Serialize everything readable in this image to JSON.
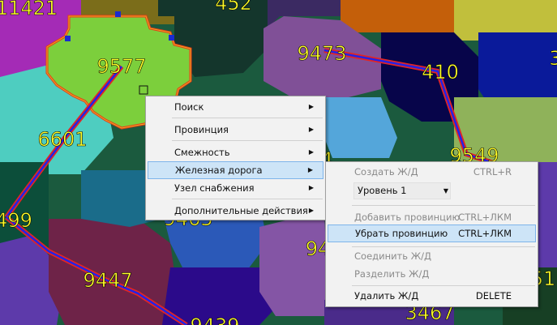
{
  "map": {
    "province_labels": [
      {
        "text": "11421",
        "dname": "province-label-11421"
      },
      {
        "text": "452",
        "dname": "province-label-452"
      },
      {
        "text": "9577",
        "dname": "province-label-9577"
      },
      {
        "text": "9473",
        "dname": "province-label-9473"
      },
      {
        "text": "410",
        "dname": "province-label-410"
      },
      {
        "text": "6601",
        "dname": "province-label-6601"
      },
      {
        "text": "9549",
        "dname": "province-label-9549"
      },
      {
        "text": "499",
        "dname": "province-label-499"
      },
      {
        "text": "9447",
        "dname": "province-label-9447"
      },
      {
        "text": "3467",
        "dname": "province-label-3467"
      },
      {
        "text": "3",
        "dname": "province-label-partial-right-top"
      },
      {
        "text": "94",
        "dname": "province-label-partial-94"
      },
      {
        "text": "51",
        "dname": "province-label-partial-51"
      },
      {
        "text": "9439",
        "dname": "province-label-partial-bottom"
      },
      {
        "text": "9463",
        "dname": "province-label-partial-hidden"
      },
      {
        "text": "4",
        "dname": "province-label-partial-4"
      }
    ],
    "selected_province": "9577",
    "railway_colors": {
      "core": "#2323e6",
      "edge": "#e32424"
    },
    "selection_color": "#e83818"
  },
  "context_menu": {
    "items": [
      {
        "label": "Поиск",
        "has_submenu": true
      },
      {
        "label": "Провинция",
        "has_submenu": true
      },
      {
        "label": "Смежность",
        "has_submenu": true
      },
      {
        "label": "Железная дорога",
        "has_submenu": true,
        "highlighted": true
      },
      {
        "label": "Узел снабжения",
        "has_submenu": true
      },
      {
        "label": "Дополнительные действия",
        "has_submenu": true
      }
    ]
  },
  "railway_submenu": {
    "create": {
      "label": "Создать Ж/Д",
      "shortcut": "CTRL+R",
      "enabled": false
    },
    "level_select": {
      "value": "Уровень 1"
    },
    "add_province": {
      "label": "Добавить провинцию",
      "shortcut": "CTRL+ЛКМ",
      "enabled": false
    },
    "remove_province": {
      "label": "Убрать провинцию",
      "shortcut": "CTRL+ЛКМ",
      "enabled": true,
      "highlighted": true
    },
    "connect": {
      "label": "Соединить Ж/Д",
      "enabled": false
    },
    "split": {
      "label": "Разделить Ж/Д",
      "enabled": false
    },
    "delete": {
      "label": "Удалить Ж/Д",
      "shortcut": "DELETE",
      "enabled": true
    }
  },
  "icons": {
    "submenu_arrow": "chevron-right-icon",
    "dropdown": "chevron-down-icon"
  },
  "colors": {
    "menu_bg": "#f2f2f2",
    "highlight_bg": "#cde4f7",
    "highlight_border": "#7eb4ea",
    "label_yellow": "#ffff28"
  }
}
